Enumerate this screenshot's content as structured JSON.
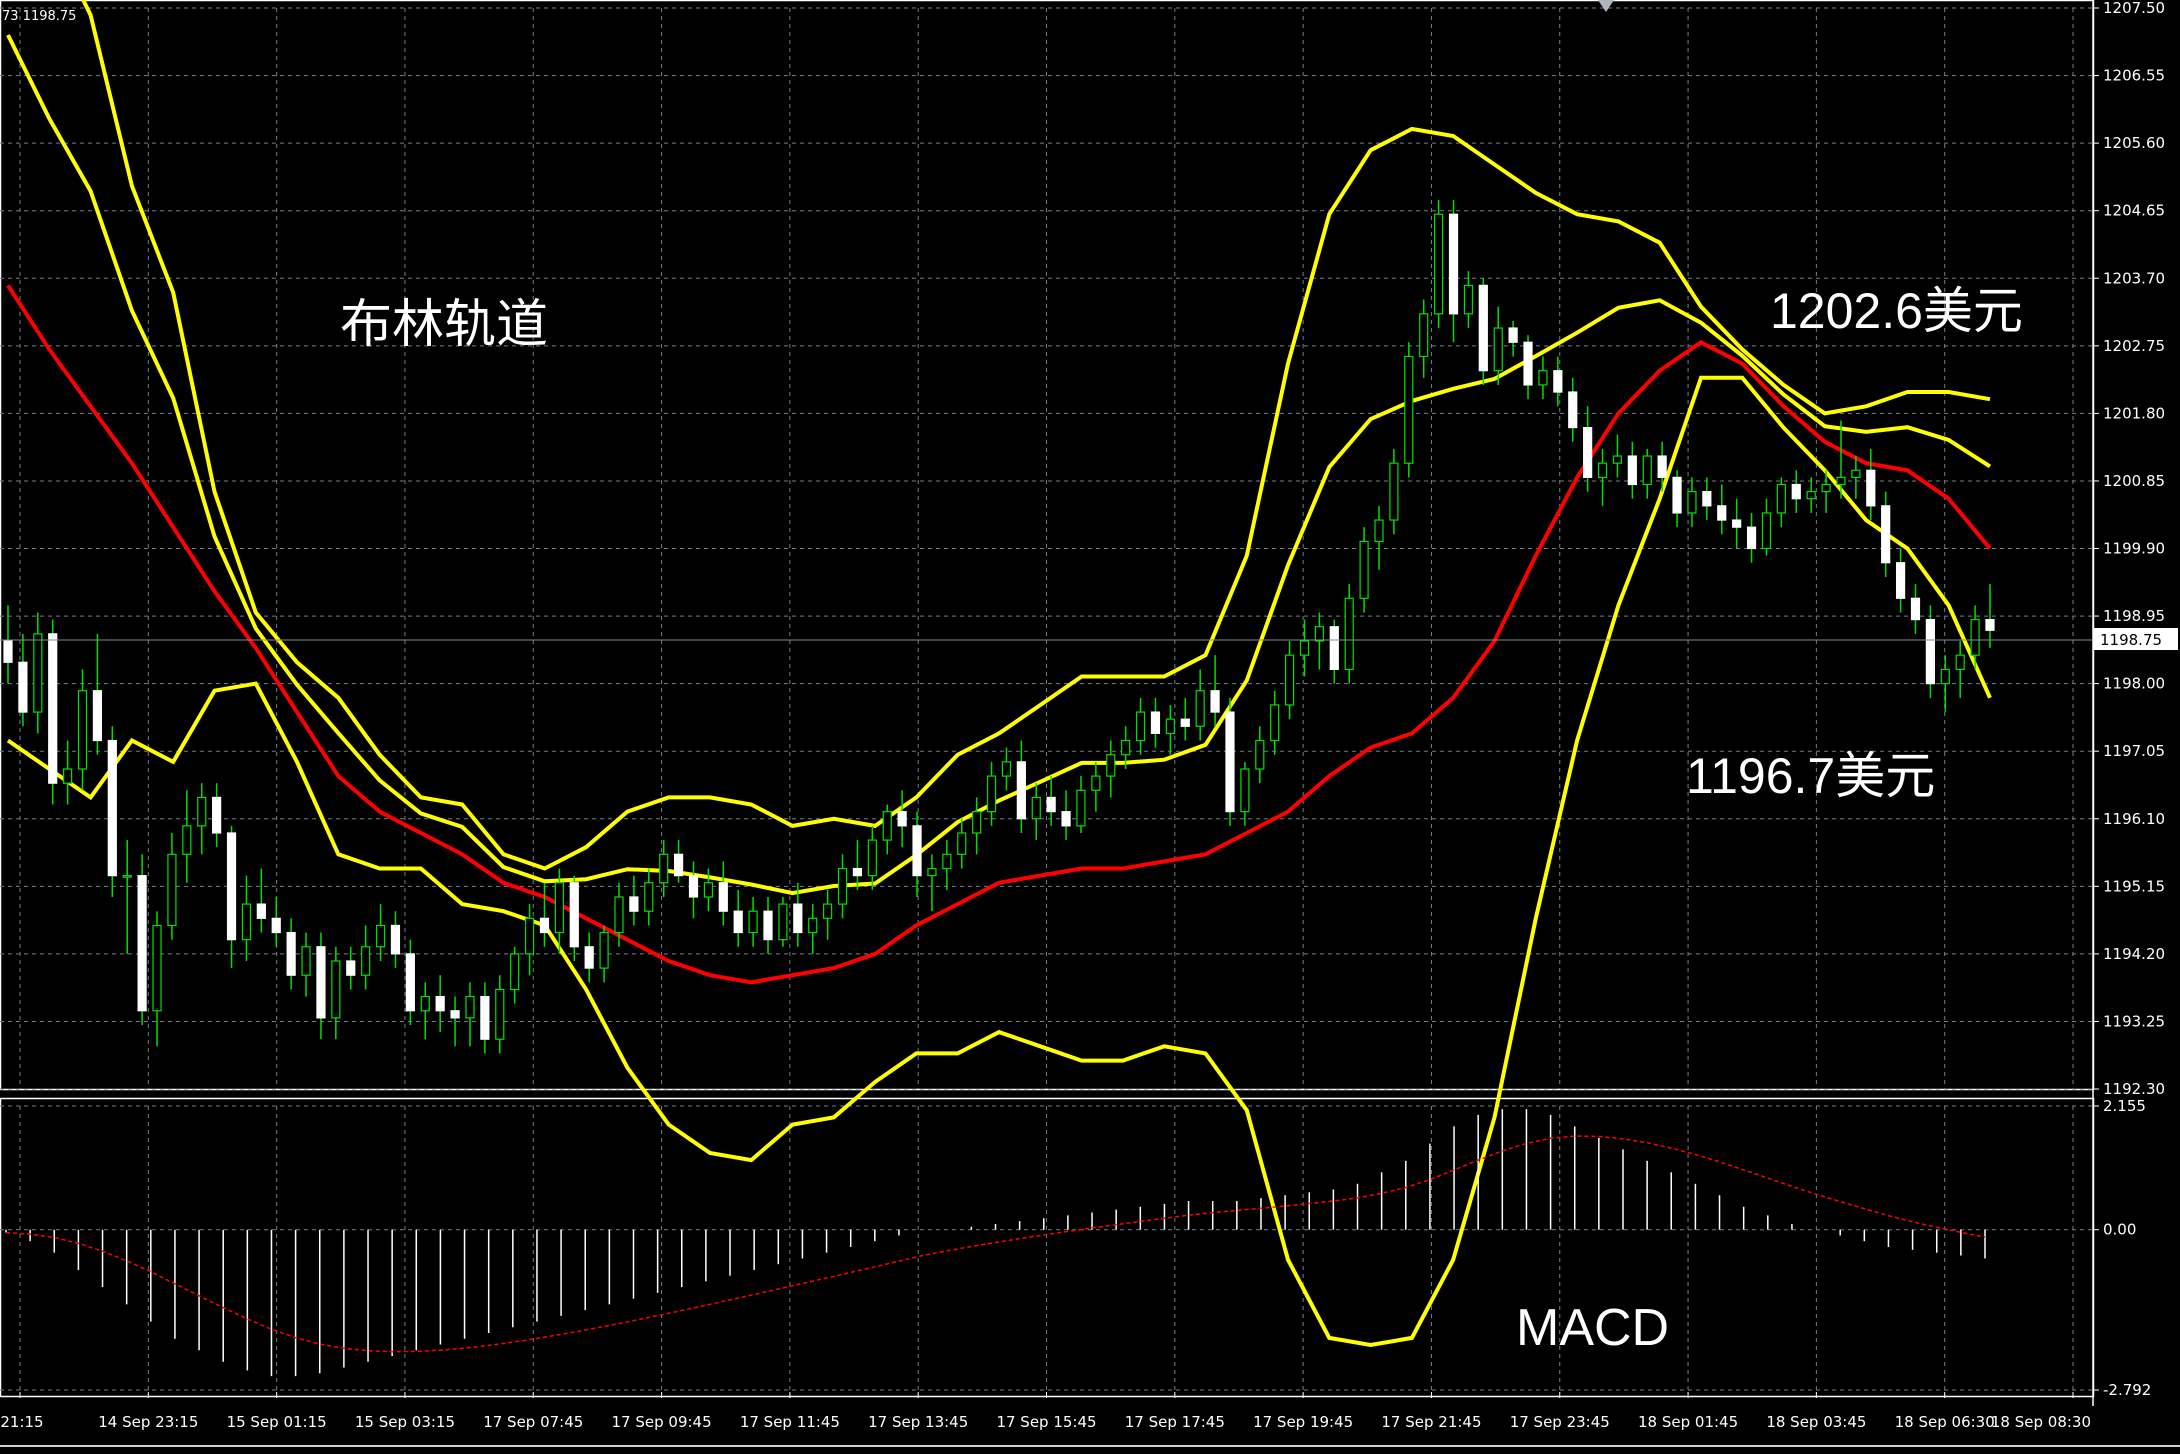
{
  "header": {
    "info": "73 1198.75"
  },
  "price_panel": {
    "ylim": [
      1192.3,
      1207.5
    ],
    "ticks": [
      "1207.50",
      "1206.55",
      "1205.60",
      "1204.65",
      "1203.70",
      "1202.75",
      "1201.80",
      "1200.85",
      "1199.90",
      "1198.95",
      "1198.00",
      "1197.05",
      "1196.10",
      "1195.15",
      "1194.20",
      "1193.25",
      "1192.30"
    ],
    "last_price": 1198.75,
    "last_price_label": "1198.75"
  },
  "macd_panel": {
    "ylim": [
      -2.792,
      2.155
    ],
    "ticks": [
      "2.155",
      "0.00",
      "-2.792"
    ],
    "label": "MACD"
  },
  "time_labels": [
    "21:15",
    "14 Sep 23:15",
    "15 Sep 01:15",
    "15 Sep 03:15",
    "17 Sep 07:45",
    "17 Sep 09:45",
    "17 Sep 11:45",
    "17 Sep 13:45",
    "17 Sep 15:45",
    "17 Sep 17:45",
    "17 Sep 19:45",
    "17 Sep 21:45",
    "17 Sep 23:45",
    "18 Sep 01:45",
    "18 Sep 03:45",
    "18 Sep 06:30",
    "18 Sep 08:30"
  ],
  "annotations": {
    "bollinger": "布林轨道",
    "upper": "1202.6美元",
    "lower": "1196.7美元",
    "macd": "MACD"
  },
  "colors": {
    "bull": "#ffffff",
    "bear": "#00e000",
    "band": "#ffff00",
    "ma": "#ff0000",
    "grid": "#6f7f8c",
    "frame": "#ffffff"
  },
  "chart_data": [
    {
      "type": "candlestick",
      "title": "",
      "ylim": [
        1192.3,
        1207.5
      ],
      "candles": [
        {
          "o": 1198.6,
          "h": 1199.1,
          "l": 1198.0,
          "c": 1198.3
        },
        {
          "o": 1198.3,
          "h": 1198.7,
          "l": 1197.4,
          "c": 1197.6
        },
        {
          "o": 1197.6,
          "h": 1199.0,
          "l": 1197.3,
          "c": 1198.7
        },
        {
          "o": 1198.7,
          "h": 1198.9,
          "l": 1196.3,
          "c": 1196.6
        },
        {
          "o": 1196.6,
          "h": 1197.2,
          "l": 1196.3,
          "c": 1196.8
        },
        {
          "o": 1196.8,
          "h": 1198.2,
          "l": 1196.5,
          "c": 1197.9
        },
        {
          "o": 1197.9,
          "h": 1198.7,
          "l": 1197.0,
          "c": 1197.2
        },
        {
          "o": 1197.2,
          "h": 1197.4,
          "l": 1195.0,
          "c": 1195.3
        },
        {
          "o": 1195.3,
          "h": 1195.8,
          "l": 1194.2,
          "c": 1195.3
        },
        {
          "o": 1195.3,
          "h": 1195.6,
          "l": 1193.2,
          "c": 1193.4
        },
        {
          "o": 1193.4,
          "h": 1194.8,
          "l": 1192.9,
          "c": 1194.6
        },
        {
          "o": 1194.6,
          "h": 1195.9,
          "l": 1194.4,
          "c": 1195.6
        },
        {
          "o": 1195.6,
          "h": 1196.5,
          "l": 1195.2,
          "c": 1196.0
        },
        {
          "o": 1196.0,
          "h": 1196.6,
          "l": 1195.6,
          "c": 1196.4
        },
        {
          "o": 1196.4,
          "h": 1196.6,
          "l": 1195.7,
          "c": 1195.9
        },
        {
          "o": 1195.9,
          "h": 1196.0,
          "l": 1194.0,
          "c": 1194.4
        },
        {
          "o": 1194.4,
          "h": 1195.3,
          "l": 1194.1,
          "c": 1194.9
        },
        {
          "o": 1194.9,
          "h": 1195.4,
          "l": 1194.5,
          "c": 1194.7
        },
        {
          "o": 1194.7,
          "h": 1195.0,
          "l": 1194.3,
          "c": 1194.5
        },
        {
          "o": 1194.5,
          "h": 1194.7,
          "l": 1193.7,
          "c": 1193.9
        },
        {
          "o": 1193.9,
          "h": 1194.5,
          "l": 1193.6,
          "c": 1194.3
        },
        {
          "o": 1194.3,
          "h": 1194.5,
          "l": 1193.0,
          "c": 1193.3
        },
        {
          "o": 1193.3,
          "h": 1194.3,
          "l": 1193.0,
          "c": 1194.1
        },
        {
          "o": 1194.1,
          "h": 1194.3,
          "l": 1193.7,
          "c": 1193.9
        },
        {
          "o": 1193.9,
          "h": 1194.6,
          "l": 1193.7,
          "c": 1194.3
        },
        {
          "o": 1194.3,
          "h": 1194.9,
          "l": 1194.1,
          "c": 1194.6
        },
        {
          "o": 1194.6,
          "h": 1194.8,
          "l": 1194.0,
          "c": 1194.2
        },
        {
          "o": 1194.2,
          "h": 1194.4,
          "l": 1193.2,
          "c": 1193.4
        },
        {
          "o": 1193.4,
          "h": 1193.8,
          "l": 1193.0,
          "c": 1193.6
        },
        {
          "o": 1193.6,
          "h": 1193.9,
          "l": 1193.1,
          "c": 1193.4
        },
        {
          "o": 1193.4,
          "h": 1193.6,
          "l": 1192.9,
          "c": 1193.3
        },
        {
          "o": 1193.3,
          "h": 1193.8,
          "l": 1192.9,
          "c": 1193.6
        },
        {
          "o": 1193.6,
          "h": 1193.8,
          "l": 1192.8,
          "c": 1193.0
        },
        {
          "o": 1193.0,
          "h": 1193.9,
          "l": 1192.8,
          "c": 1193.7
        },
        {
          "o": 1193.7,
          "h": 1194.3,
          "l": 1193.5,
          "c": 1194.2
        },
        {
          "o": 1194.2,
          "h": 1194.9,
          "l": 1193.9,
          "c": 1194.7
        },
        {
          "o": 1194.7,
          "h": 1195.2,
          "l": 1194.3,
          "c": 1194.5
        },
        {
          "o": 1194.5,
          "h": 1195.4,
          "l": 1194.2,
          "c": 1195.2
        },
        {
          "o": 1195.2,
          "h": 1195.3,
          "l": 1194.1,
          "c": 1194.3
        },
        {
          "o": 1194.3,
          "h": 1194.5,
          "l": 1193.8,
          "c": 1194.0
        },
        {
          "o": 1194.0,
          "h": 1194.6,
          "l": 1193.8,
          "c": 1194.5
        },
        {
          "o": 1194.5,
          "h": 1195.2,
          "l": 1194.3,
          "c": 1195.0
        },
        {
          "o": 1195.0,
          "h": 1195.3,
          "l": 1194.6,
          "c": 1194.8
        },
        {
          "o": 1194.8,
          "h": 1195.4,
          "l": 1194.6,
          "c": 1195.2
        },
        {
          "o": 1195.2,
          "h": 1195.8,
          "l": 1195.0,
          "c": 1195.6
        },
        {
          "o": 1195.6,
          "h": 1195.8,
          "l": 1195.2,
          "c": 1195.3
        },
        {
          "o": 1195.3,
          "h": 1195.5,
          "l": 1194.7,
          "c": 1195.0
        },
        {
          "o": 1195.0,
          "h": 1195.4,
          "l": 1194.8,
          "c": 1195.2
        },
        {
          "o": 1195.2,
          "h": 1195.5,
          "l": 1194.6,
          "c": 1194.8
        },
        {
          "o": 1194.8,
          "h": 1195.1,
          "l": 1194.3,
          "c": 1194.5
        },
        {
          "o": 1194.5,
          "h": 1195.0,
          "l": 1194.3,
          "c": 1194.8
        },
        {
          "o": 1194.8,
          "h": 1195.0,
          "l": 1194.2,
          "c": 1194.4
        },
        {
          "o": 1194.4,
          "h": 1195.0,
          "l": 1194.3,
          "c": 1194.9
        },
        {
          "o": 1194.9,
          "h": 1195.2,
          "l": 1194.3,
          "c": 1194.5
        },
        {
          "o": 1194.5,
          "h": 1194.9,
          "l": 1194.2,
          "c": 1194.7
        },
        {
          "o": 1194.7,
          "h": 1195.1,
          "l": 1194.4,
          "c": 1194.9
        },
        {
          "o": 1194.9,
          "h": 1195.6,
          "l": 1194.7,
          "c": 1195.4
        },
        {
          "o": 1195.4,
          "h": 1195.8,
          "l": 1195.1,
          "c": 1195.3
        },
        {
          "o": 1195.3,
          "h": 1196.0,
          "l": 1195.1,
          "c": 1195.8
        },
        {
          "o": 1195.8,
          "h": 1196.3,
          "l": 1195.6,
          "c": 1196.2
        },
        {
          "o": 1196.2,
          "h": 1196.5,
          "l": 1195.7,
          "c": 1196.0
        },
        {
          "o": 1196.0,
          "h": 1196.2,
          "l": 1195.0,
          "c": 1195.3
        },
        {
          "o": 1195.3,
          "h": 1195.6,
          "l": 1194.8,
          "c": 1195.4
        },
        {
          "o": 1195.4,
          "h": 1195.8,
          "l": 1195.1,
          "c": 1195.6
        },
        {
          "o": 1195.6,
          "h": 1196.1,
          "l": 1195.4,
          "c": 1195.9
        },
        {
          "o": 1195.9,
          "h": 1196.4,
          "l": 1195.6,
          "c": 1196.2
        },
        {
          "o": 1196.2,
          "h": 1196.9,
          "l": 1196.0,
          "c": 1196.7
        },
        {
          "o": 1196.7,
          "h": 1197.1,
          "l": 1196.5,
          "c": 1196.9
        },
        {
          "o": 1196.9,
          "h": 1197.2,
          "l": 1195.9,
          "c": 1196.1
        },
        {
          "o": 1196.1,
          "h": 1196.6,
          "l": 1195.8,
          "c": 1196.4
        },
        {
          "o": 1196.4,
          "h": 1196.7,
          "l": 1196.0,
          "c": 1196.2
        },
        {
          "o": 1196.2,
          "h": 1196.5,
          "l": 1195.8,
          "c": 1196.0
        },
        {
          "o": 1196.0,
          "h": 1196.7,
          "l": 1195.9,
          "c": 1196.5
        },
        {
          "o": 1196.5,
          "h": 1196.9,
          "l": 1196.2,
          "c": 1196.7
        },
        {
          "o": 1196.7,
          "h": 1197.2,
          "l": 1196.4,
          "c": 1197.0
        },
        {
          "o": 1197.0,
          "h": 1197.4,
          "l": 1196.8,
          "c": 1197.2
        },
        {
          "o": 1197.2,
          "h": 1197.8,
          "l": 1197.0,
          "c": 1197.6
        },
        {
          "o": 1197.6,
          "h": 1197.8,
          "l": 1197.1,
          "c": 1197.3
        },
        {
          "o": 1197.3,
          "h": 1197.7,
          "l": 1197.0,
          "c": 1197.5
        },
        {
          "o": 1197.5,
          "h": 1197.8,
          "l": 1197.2,
          "c": 1197.4
        },
        {
          "o": 1197.4,
          "h": 1198.2,
          "l": 1197.2,
          "c": 1197.9
        },
        {
          "o": 1197.9,
          "h": 1198.4,
          "l": 1197.4,
          "c": 1197.6
        },
        {
          "o": 1197.6,
          "h": 1197.8,
          "l": 1196.0,
          "c": 1196.2
        },
        {
          "o": 1196.2,
          "h": 1196.9,
          "l": 1196.0,
          "c": 1196.8
        },
        {
          "o": 1196.8,
          "h": 1197.4,
          "l": 1196.6,
          "c": 1197.2
        },
        {
          "o": 1197.2,
          "h": 1197.9,
          "l": 1197.0,
          "c": 1197.7
        },
        {
          "o": 1197.7,
          "h": 1198.6,
          "l": 1197.5,
          "c": 1198.4
        },
        {
          "o": 1198.4,
          "h": 1198.9,
          "l": 1198.1,
          "c": 1198.6
        },
        {
          "o": 1198.6,
          "h": 1199.0,
          "l": 1198.2,
          "c": 1198.8
        },
        {
          "o": 1198.8,
          "h": 1198.9,
          "l": 1198.0,
          "c": 1198.2
        },
        {
          "o": 1198.2,
          "h": 1199.4,
          "l": 1198.0,
          "c": 1199.2
        },
        {
          "o": 1199.2,
          "h": 1200.2,
          "l": 1199.0,
          "c": 1200.0
        },
        {
          "o": 1200.0,
          "h": 1200.5,
          "l": 1199.6,
          "c": 1200.3
        },
        {
          "o": 1200.3,
          "h": 1201.3,
          "l": 1200.1,
          "c": 1201.1
        },
        {
          "o": 1201.1,
          "h": 1202.8,
          "l": 1200.9,
          "c": 1202.6
        },
        {
          "o": 1202.6,
          "h": 1203.4,
          "l": 1202.3,
          "c": 1203.2
        },
        {
          "o": 1203.2,
          "h": 1204.8,
          "l": 1203.0,
          "c": 1204.6
        },
        {
          "o": 1204.6,
          "h": 1204.8,
          "l": 1202.8,
          "c": 1203.2
        },
        {
          "o": 1203.2,
          "h": 1203.8,
          "l": 1203.0,
          "c": 1203.6
        },
        {
          "o": 1203.6,
          "h": 1203.7,
          "l": 1202.2,
          "c": 1202.4
        },
        {
          "o": 1202.4,
          "h": 1203.3,
          "l": 1202.2,
          "c": 1203.0
        },
        {
          "o": 1203.0,
          "h": 1203.1,
          "l": 1202.6,
          "c": 1202.8
        },
        {
          "o": 1202.8,
          "h": 1202.9,
          "l": 1202.0,
          "c": 1202.2
        },
        {
          "o": 1202.2,
          "h": 1202.6,
          "l": 1202.0,
          "c": 1202.4
        },
        {
          "o": 1202.4,
          "h": 1202.6,
          "l": 1201.9,
          "c": 1202.1
        },
        {
          "o": 1202.1,
          "h": 1202.3,
          "l": 1201.4,
          "c": 1201.6
        },
        {
          "o": 1201.6,
          "h": 1201.9,
          "l": 1200.7,
          "c": 1200.9
        },
        {
          "o": 1200.9,
          "h": 1201.3,
          "l": 1200.5,
          "c": 1201.1
        },
        {
          "o": 1201.1,
          "h": 1201.5,
          "l": 1200.9,
          "c": 1201.2
        },
        {
          "o": 1201.2,
          "h": 1201.4,
          "l": 1200.6,
          "c": 1200.8
        },
        {
          "o": 1200.8,
          "h": 1201.3,
          "l": 1200.6,
          "c": 1201.2
        },
        {
          "o": 1201.2,
          "h": 1201.4,
          "l": 1200.7,
          "c": 1200.9
        },
        {
          "o": 1200.9,
          "h": 1201.0,
          "l": 1200.2,
          "c": 1200.4
        },
        {
          "o": 1200.4,
          "h": 1200.9,
          "l": 1200.2,
          "c": 1200.7
        },
        {
          "o": 1200.7,
          "h": 1200.9,
          "l": 1200.3,
          "c": 1200.5
        },
        {
          "o": 1200.5,
          "h": 1200.8,
          "l": 1200.1,
          "c": 1200.3
        },
        {
          "o": 1200.3,
          "h": 1200.6,
          "l": 1199.9,
          "c": 1200.2
        },
        {
          "o": 1200.2,
          "h": 1200.4,
          "l": 1199.7,
          "c": 1199.9
        },
        {
          "o": 1199.9,
          "h": 1200.6,
          "l": 1199.8,
          "c": 1200.4
        },
        {
          "o": 1200.4,
          "h": 1200.9,
          "l": 1200.2,
          "c": 1200.8
        },
        {
          "o": 1200.8,
          "h": 1201.0,
          "l": 1200.4,
          "c": 1200.6
        },
        {
          "o": 1200.6,
          "h": 1200.9,
          "l": 1200.4,
          "c": 1200.7
        },
        {
          "o": 1200.7,
          "h": 1201.0,
          "l": 1200.4,
          "c": 1200.8
        },
        {
          "o": 1200.8,
          "h": 1201.7,
          "l": 1200.6,
          "c": 1200.9
        },
        {
          "o": 1200.9,
          "h": 1201.2,
          "l": 1200.6,
          "c": 1201.0
        },
        {
          "o": 1201.0,
          "h": 1201.3,
          "l": 1200.3,
          "c": 1200.5
        },
        {
          "o": 1200.5,
          "h": 1200.7,
          "l": 1199.5,
          "c": 1199.7
        },
        {
          "o": 1199.7,
          "h": 1199.9,
          "l": 1199.0,
          "c": 1199.2
        },
        {
          "o": 1199.2,
          "h": 1199.4,
          "l": 1198.7,
          "c": 1198.9
        },
        {
          "o": 1198.9,
          "h": 1199.1,
          "l": 1197.8,
          "c": 1198.0
        },
        {
          "o": 1198.0,
          "h": 1198.4,
          "l": 1197.6,
          "c": 1198.2
        },
        {
          "o": 1198.2,
          "h": 1198.6,
          "l": 1197.8,
          "c": 1198.4
        },
        {
          "o": 1198.4,
          "h": 1199.1,
          "l": 1198.2,
          "c": 1198.9
        },
        {
          "o": 1198.9,
          "h": 1199.4,
          "l": 1198.5,
          "c": 1198.75
        }
      ],
      "bollinger_upper": [
        1210.0,
        1208.6,
        1207.4,
        1205.0,
        1203.5,
        1200.7,
        1199.0,
        1198.3,
        1197.8,
        1197.0,
        1196.4,
        1196.3,
        1195.6,
        1195.4,
        1195.7,
        1196.2,
        1196.4,
        1196.4,
        1196.3,
        1196.0,
        1196.1,
        1196.0,
        1196.4,
        1197.0,
        1197.3,
        1197.7,
        1198.1,
        1198.1,
        1198.1,
        1198.4,
        1199.8,
        1202.5,
        1204.6,
        1205.5,
        1205.8,
        1205.7,
        1205.3,
        1204.9,
        1204.6,
        1204.5,
        1204.2,
        1203.3,
        1202.7,
        1202.2,
        1201.8,
        1201.9,
        1202.1,
        1202.1,
        1202.0
      ],
      "bollinger_mid": [
        1203.6,
        1202.7,
        1201.9,
        1201.1,
        1200.2,
        1199.3,
        1198.5,
        1197.6,
        1196.7,
        1196.2,
        1195.9,
        1195.6,
        1195.2,
        1195.0,
        1194.7,
        1194.4,
        1194.1,
        1193.9,
        1193.8,
        1193.9,
        1194.0,
        1194.2,
        1194.6,
        1194.9,
        1195.2,
        1195.3,
        1195.4,
        1195.4,
        1195.5,
        1195.6,
        1195.9,
        1196.2,
        1196.7,
        1197.1,
        1197.3,
        1197.8,
        1198.6,
        1199.8,
        1200.9,
        1201.8,
        1202.4,
        1202.8,
        1202.5,
        1201.9,
        1201.4,
        1201.1,
        1201.0,
        1200.6,
        1199.9
      ]
    },
    {
      "type": "bar",
      "title": "MACD",
      "ylim": [
        -2.792,
        2.155
      ],
      "series": [
        {
          "name": "MACD",
          "values": [
            -0.05,
            -0.2,
            -0.4,
            -0.7,
            -1.0,
            -1.3,
            -1.6,
            -1.9,
            -2.1,
            -2.3,
            -2.45,
            -2.55,
            -2.55,
            -2.5,
            -2.4,
            -2.3,
            -2.2,
            -2.1,
            -2.0,
            -1.9,
            -1.8,
            -1.7,
            -1.6,
            -1.5,
            -1.4,
            -1.3,
            -1.2,
            -1.1,
            -1.0,
            -0.9,
            -0.8,
            -0.7,
            -0.6,
            -0.5,
            -0.4,
            -0.3,
            -0.2,
            -0.1,
            0.0,
            0.0,
            0.05,
            0.1,
            0.15,
            0.2,
            0.25,
            0.3,
            0.35,
            0.4,
            0.45,
            0.5,
            0.5,
            0.5,
            0.55,
            0.6,
            0.65,
            0.7,
            0.8,
            1.0,
            1.2,
            1.5,
            1.8,
            2.0,
            2.1,
            2.1,
            2.0,
            1.8,
            1.6,
            1.4,
            1.2,
            1.0,
            0.8,
            0.6,
            0.4,
            0.25,
            0.1,
            0.0,
            -0.1,
            -0.2,
            -0.3,
            -0.35,
            -0.4,
            -0.45,
            -0.5
          ]
        }
      ]
    }
  ]
}
